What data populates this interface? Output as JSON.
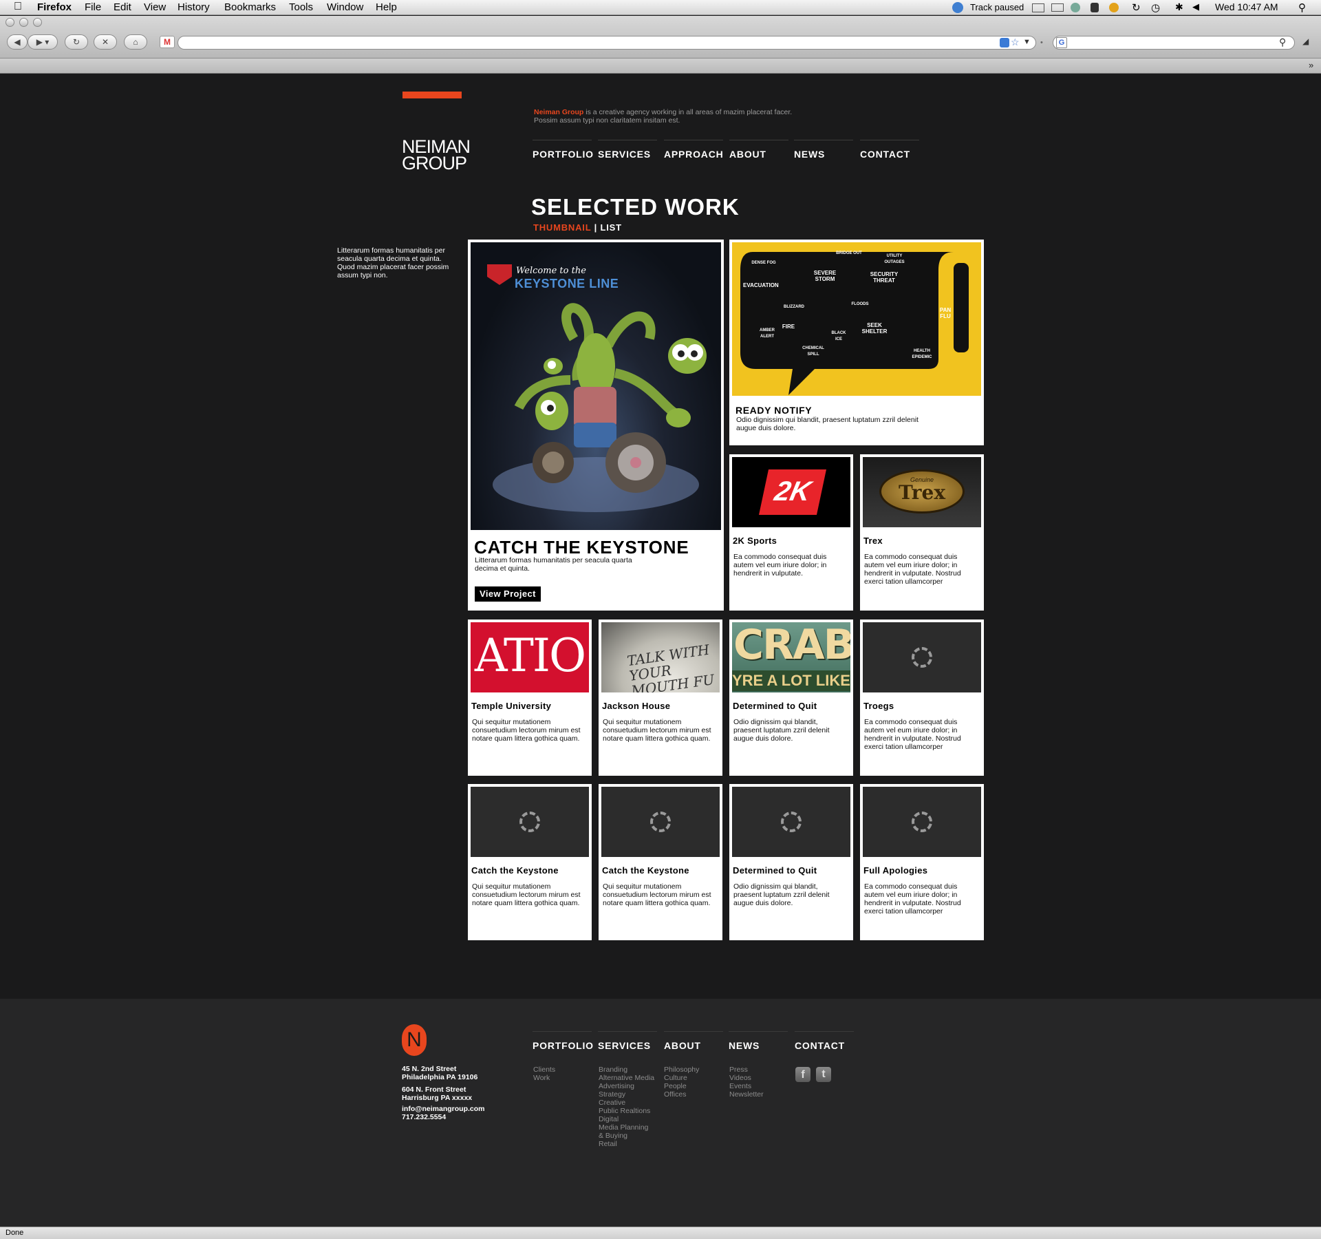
{
  "menubar": {
    "app": "Firefox",
    "items": [
      "File",
      "Edit",
      "View",
      "History",
      "Bookmarks",
      "Tools",
      "Window",
      "Help"
    ],
    "track_status": "Track paused",
    "clock": "Wed 10:47 AM"
  },
  "browser": {
    "url": "",
    "search_placeholder": "",
    "status": "Done"
  },
  "header": {
    "logo_line1": "NEIMAN",
    "logo_line2": "GROUP",
    "tagline_brand": "Neiman Group",
    "tagline_rest": " is a creative agency working in all areas of mazim placerat facer. Possim assum typi non claritatem insitam est.",
    "nav": [
      "PORTFOLIO",
      "SERVICES",
      "APPROACH",
      "ABOUT",
      "NEWS",
      "CONTACT"
    ]
  },
  "main": {
    "title": "SELECTED WORK",
    "view_thumbnail": "THUMBNAIL",
    "view_sep": "|",
    "view_list": "LIST",
    "sidebar_text": "Litterarum formas humanitatis per seacula quarta decima et quinta. Quod mazim placerat facer possim assum typi non."
  },
  "feature": {
    "thumb_line1": "Welcome to the",
    "thumb_line2": "KEYSTONE LINE",
    "title": "CATCH THE KEYSTONE",
    "desc": "Litterarum formas humanitatis per seacula quarta decima et quinta.",
    "button": "View Project"
  },
  "ready_notify": {
    "title": "READY NOTIFY",
    "desc": "Odio dignissim qui blandit, praesent luptatum zzril delenit augue duis dolore.",
    "words": [
      "SEVERE STORM",
      "SECURITY THREAT",
      "EVACUATION",
      "FIRE",
      "SEEK SHELTER",
      "PAN FLU",
      "FLOODS",
      "BLIZZARD",
      "AMBER ALERT",
      "BLACK ICE",
      "CHEMICAL SPILL",
      "HEALTH EPIDEMIC",
      "UTILITY OUTAGES",
      "DENSE FOG",
      "BRIDGE OUT"
    ]
  },
  "cards": [
    {
      "title": "2K Sports",
      "desc": "Ea commodo consequat duis autem vel eum iriure dolor; in hendrerit in vulputate.",
      "thumb": "2K"
    },
    {
      "title": "Trex",
      "desc": "Ea commodo consequat duis autem vel eum iriure dolor; in hendrerit in vulputate. Nostrud exerci tation ullamcorper",
      "thumb": "Trex",
      "thumb_small": "Genuine"
    },
    {
      "title": "Temple University",
      "desc": "Qui sequitur mutationem consuetudium lectorum mirum est notare quam littera gothica quam.",
      "thumb": "ATIO"
    },
    {
      "title": "Jackson House",
      "desc": "Qui sequitur mutationem consuetudium lectorum mirum est notare quam littera gothica quam.",
      "thumb": "TALK WITH YOUR MOUTH FU"
    },
    {
      "title": "Determined to Quit",
      "desc": "Odio dignissim qui blandit, praesent luptatum zzril delenit augue duis dolore.",
      "thumb": "CRABS",
      "thumb_small": "YRE A LOT LIKE CO"
    },
    {
      "title": "Troegs",
      "desc": "Ea commodo consequat duis autem vel eum iriure dolor; in hendrerit in vulputate. Nostrud exerci tation ullamcorper"
    },
    {
      "title": "Catch the Keystone",
      "desc": "Qui sequitur mutationem consuetudium lectorum mirum est notare quam littera gothica quam."
    },
    {
      "title": "Catch the Keystone",
      "desc": "Qui sequitur mutationem consuetudium lectorum mirum est notare quam littera gothica quam."
    },
    {
      "title": "Determined to Quit",
      "desc": "Odio dignissim qui blandit, praesent luptatum zzril delenit augue duis dolore."
    },
    {
      "title": "Full Apologies",
      "desc": "Ea commodo consequat duis autem vel eum iriure dolor; in hendrerit in vulputate. Nostrud exerci tation ullamcorper"
    }
  ],
  "footer": {
    "logo_letter": "N",
    "address1_line1": "45 N. 2nd Street",
    "address1_line2": "Philadelphia PA 19106",
    "address2_line1": "604 N. Front Street",
    "address2_line2": "Harrisburg PA xxxxx",
    "email": "info@neimangroup.com",
    "phone": "717.232.5554",
    "cols": [
      {
        "heading": "PORTFOLIO",
        "links": [
          "Clients",
          "Work"
        ]
      },
      {
        "heading": "SERVICES",
        "links": [
          "Branding",
          "Alternative Media",
          "Advertising",
          "Strategy",
          "Creative",
          "Public Realtions",
          "Digital",
          "Media Planning",
          "& Buying",
          "Retail"
        ]
      },
      {
        "heading": "ABOUT",
        "links": [
          "Philosophy",
          "Culture",
          "People",
          "Offices"
        ]
      },
      {
        "heading": "NEWS",
        "links": [
          "Press",
          "Videos",
          "Events",
          "Newsletter"
        ]
      },
      {
        "heading": "CONTACT",
        "links": []
      }
    ],
    "social": [
      "f",
      "t"
    ]
  }
}
